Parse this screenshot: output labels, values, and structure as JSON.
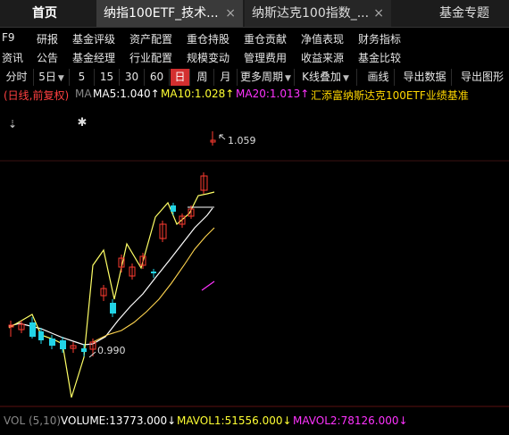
{
  "tabs": {
    "home": "首页",
    "tab1": "纳指100ETF_技术...",
    "tab2": "纳斯达克100指数_...",
    "close_glyph": "×",
    "fund_topics": "基金专题"
  },
  "menu_row1": [
    "F9",
    "研报",
    "基金评级",
    "资产配置",
    "重仓持股",
    "重仓贡献",
    "净值表现",
    "财务指标"
  ],
  "menu_row2": [
    "资讯",
    "公告",
    "基金经理",
    "行业配置",
    "规模变动",
    "管理费用",
    "收益来源",
    "基金比较"
  ],
  "toolbar": {
    "fenshi": "分时",
    "day5": "5日",
    "m5": "5",
    "m15": "15",
    "m30": "30",
    "m60": "60",
    "day": "日",
    "week": "周",
    "month": "月",
    "more_periods": "更多周期",
    "kline_overlay": "K线叠加",
    "draw_line": "画线",
    "export_data": "导出数据",
    "export_chart": "导出图形",
    "dropdown_glyph": "▼"
  },
  "legend": {
    "mode": "(日线,前复权)",
    "ma": "MA",
    "ma5": "MA5:1.040↑",
    "ma10": "MA10:1.028↑",
    "ma20": "MA20:1.013↑",
    "benchmark": "汇添富纳斯达克100ETF业绩基准"
  },
  "chart": {
    "high_label": "1.059",
    "low_label": "0.990",
    "marker_glyph": "✱",
    "pin_glyph": "⇣"
  },
  "volume": {
    "label": "VOL (5,10)",
    "volume": "VOLUME:13773.000↓",
    "mavol1": "MAVOL1:51556.000↓",
    "mavol2": "MAVOL2:78126.000↓"
  },
  "colors": {
    "up": "#ff3b30",
    "down": "#22d4e6",
    "ma5": "#ffffff",
    "ma10": "#ffff33",
    "ma20": "#ff33ff",
    "benchmark": "#ffd700",
    "accent_active": "#d32f2f"
  }
}
